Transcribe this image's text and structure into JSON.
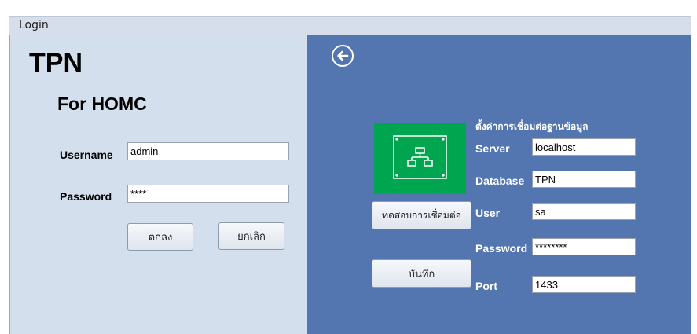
{
  "window": {
    "title": "Login"
  },
  "login": {
    "app_title": "TPN",
    "app_subtitle": "For HOMC",
    "username_label": "Username",
    "username_value": "admin",
    "password_label": "Password",
    "password_value": "****",
    "ok_label": "ตกลง",
    "cancel_label": "ยกเลิก"
  },
  "settings": {
    "section_title": "ตั้งค่าการเชื่อมต่อฐานข้อมูล",
    "server_label": "Server",
    "server_value": "localhost",
    "database_label": "Database",
    "database_value": "TPN",
    "user_label": "User",
    "user_value": "sa",
    "password_label": "Password",
    "password_value": "********",
    "port_label": "Port",
    "port_value": "1433",
    "test_label": "ทดสอบการเชื่อมต่อ",
    "save_label": "บันทึก"
  },
  "icons": {
    "back": "arrow-left-circle-icon",
    "network": "network-hierarchy-icon"
  },
  "colors": {
    "left_panel": "#d4dfee",
    "right_panel": "#5476b0",
    "network_tile": "#00a550"
  }
}
